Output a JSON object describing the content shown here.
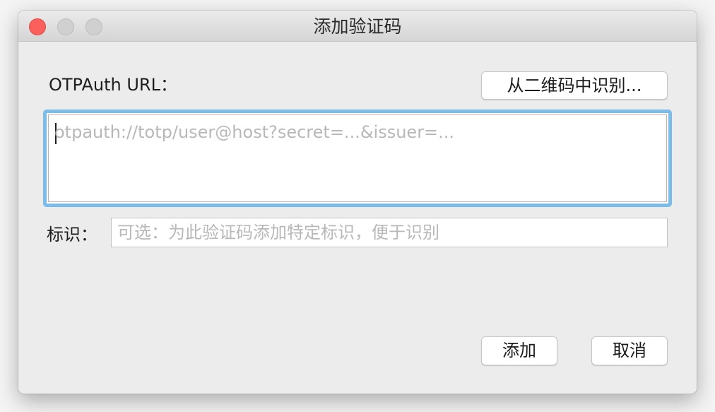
{
  "window": {
    "title": "添加验证码"
  },
  "form": {
    "otpauth_label": "OTPAuth URL：",
    "scan_qr_button": "从二维码中识别...",
    "otpauth_placeholder": "otpauth://totp/user@host?secret=...&issuer=...",
    "identifier_label": "标识：",
    "identifier_placeholder": "可选：为此验证码添加特定标识，便于识别"
  },
  "actions": {
    "add_button": "添加",
    "cancel_button": "取消"
  },
  "colors": {
    "close_button": "#fc605c",
    "focus_ring": "#7bbce8",
    "window_background": "#ececec"
  },
  "icons": {
    "close": "close-icon",
    "minimize": "minimize-icon",
    "zoom": "zoom-icon"
  }
}
